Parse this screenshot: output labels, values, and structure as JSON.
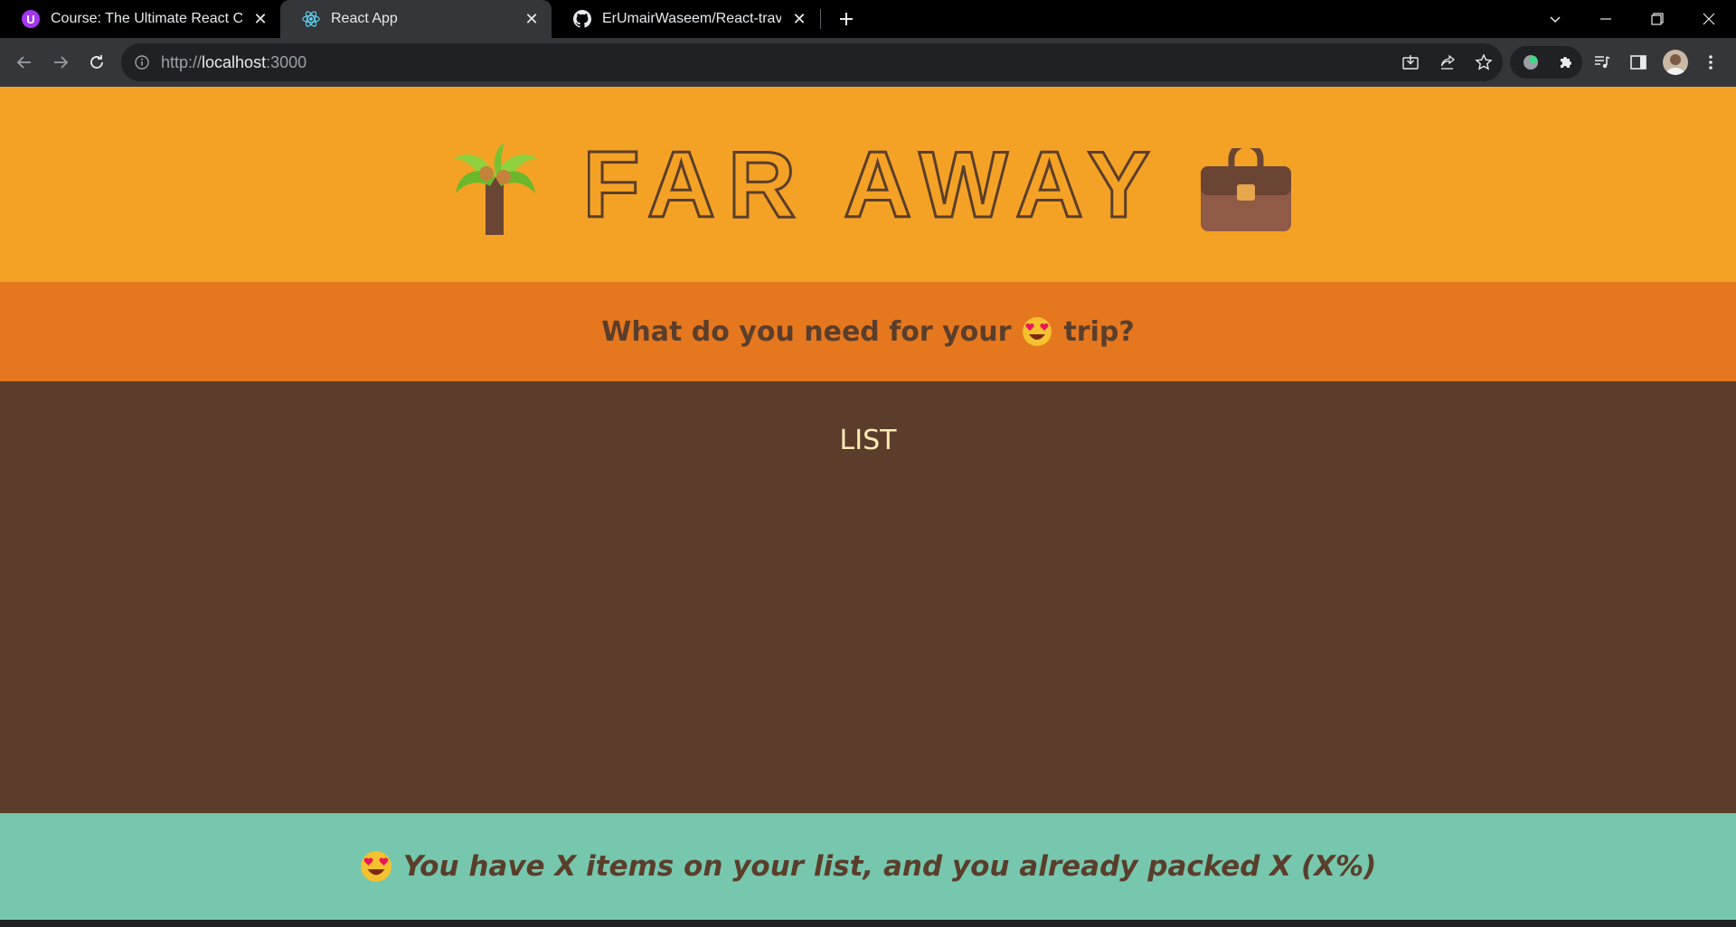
{
  "browser": {
    "tabs": [
      {
        "label": "Course: The Ultimate React Cour",
        "favicon": "udemy-icon",
        "active": false
      },
      {
        "label": "React App",
        "favicon": "react-icon",
        "active": true
      },
      {
        "label": "ErUmairWaseem/React-travel-lis",
        "favicon": "github-icon",
        "active": false
      }
    ],
    "url_scheme": "http://",
    "url_host": "localhost",
    "url_port": ":3000"
  },
  "app": {
    "title": "FAR AWAY",
    "left_emoji": "palm-tree-icon",
    "right_emoji": "briefcase-icon",
    "form_question_before": "What do you need for your",
    "form_question_after": "trip?",
    "form_emoji": "heart-eyes-icon",
    "list_label": "LIST",
    "stats_text": "You have X items on your list, and you already packed X (X%)",
    "stats_emoji": "heart-eyes-icon"
  },
  "colors": {
    "header": "#f4a226",
    "form": "#e5771f",
    "list": "#5a3e2b",
    "stats": "#76c7ad",
    "text_dark": "#5a3e2b",
    "text_light": "#ffebb3"
  }
}
